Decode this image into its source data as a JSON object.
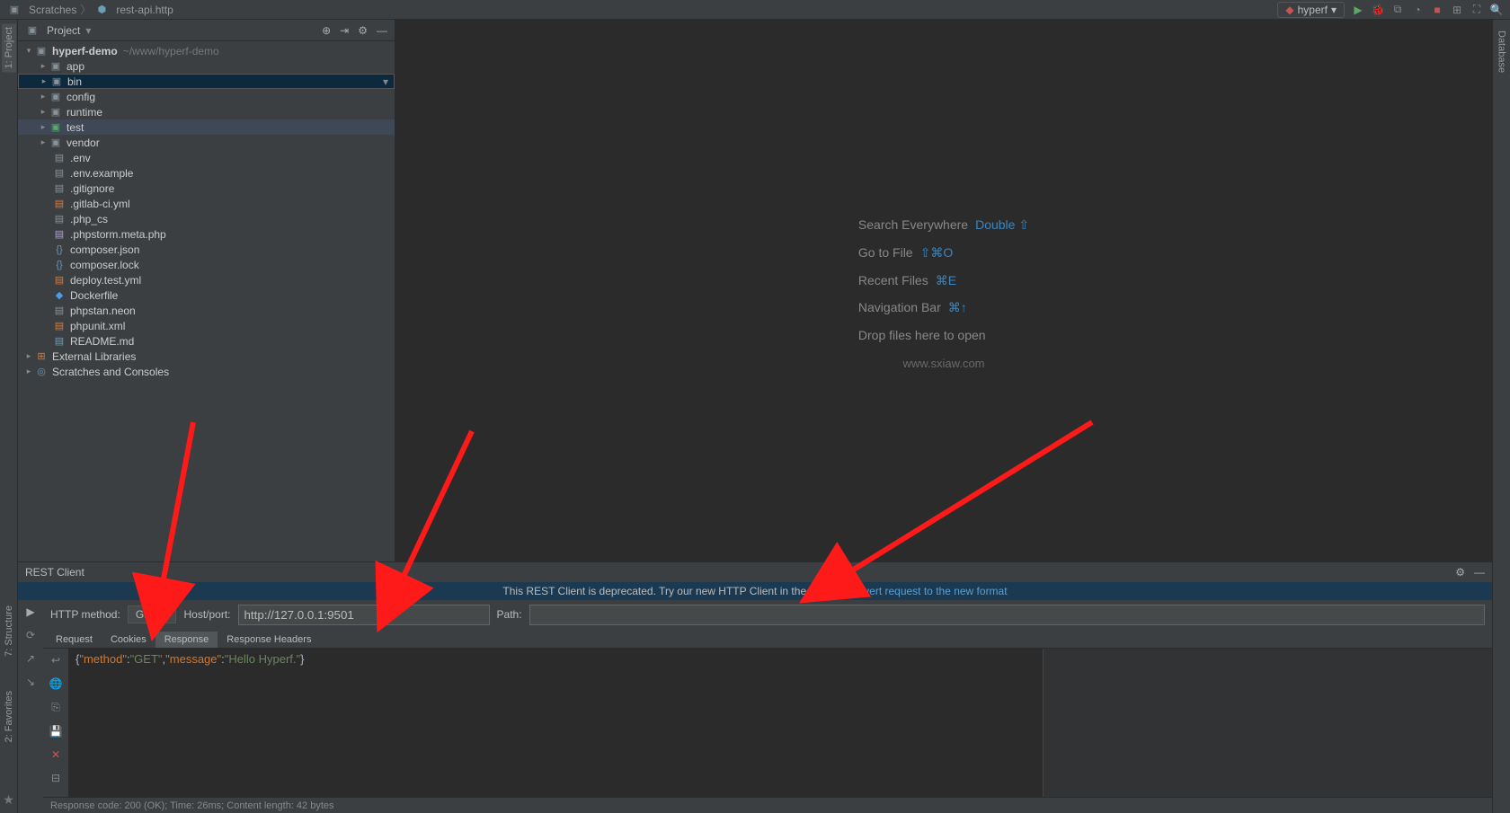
{
  "breadcrumb": {
    "root": "Scratches",
    "file": "rest-api.http"
  },
  "runConfig": "hyperf",
  "projectPanel": {
    "title": "Project"
  },
  "tree": {
    "root": {
      "name": "hyperf-demo",
      "path": "~/www/hyperf-demo"
    },
    "folders": [
      "app",
      "bin",
      "config",
      "runtime",
      "test",
      "vendor"
    ],
    "files": [
      ".env",
      ".env.example",
      ".gitignore",
      ".gitlab-ci.yml",
      ".php_cs",
      ".phpstorm.meta.php",
      "composer.json",
      "composer.lock",
      "deploy.test.yml",
      "Dockerfile",
      "phpstan.neon",
      "phpunit.xml",
      "README.md"
    ],
    "extra": [
      "External Libraries",
      "Scratches and Consoles"
    ]
  },
  "hints": {
    "search": "Search Everywhere",
    "searchKey": "Double ⇧",
    "goto": "Go to File",
    "gotoKey": "⇧⌘O",
    "recent": "Recent Files",
    "recentKey": "⌘E",
    "nav": "Navigation Bar",
    "navKey": "⌘↑",
    "drop": "Drop files here to open"
  },
  "watermark": "www.sxiaw.com",
  "restPanel": {
    "title": "REST Client",
    "deprecated": "This REST Client is deprecated. Try our new HTTP Client in the editor.",
    "deprecatedLink": "Convert request to the new format",
    "methodLabel": "HTTP method:",
    "method": "GET",
    "hostLabel": "Host/port:",
    "host": "http://127.0.0.1:9501",
    "pathLabel": "Path:",
    "path": "",
    "tabs": [
      "Request",
      "Cookies",
      "Response",
      "Response Headers"
    ],
    "activeTab": "Response",
    "response": {
      "method": "GET",
      "message": "Hello Hyperf."
    },
    "status": "Response code: 200 (OK); Time: 26ms; Content length: 42 bytes"
  },
  "leftTabs": {
    "project": "1: Project",
    "structure": "7: Structure",
    "favorites": "2: Favorites"
  },
  "rightTabs": {
    "database": "Database"
  }
}
